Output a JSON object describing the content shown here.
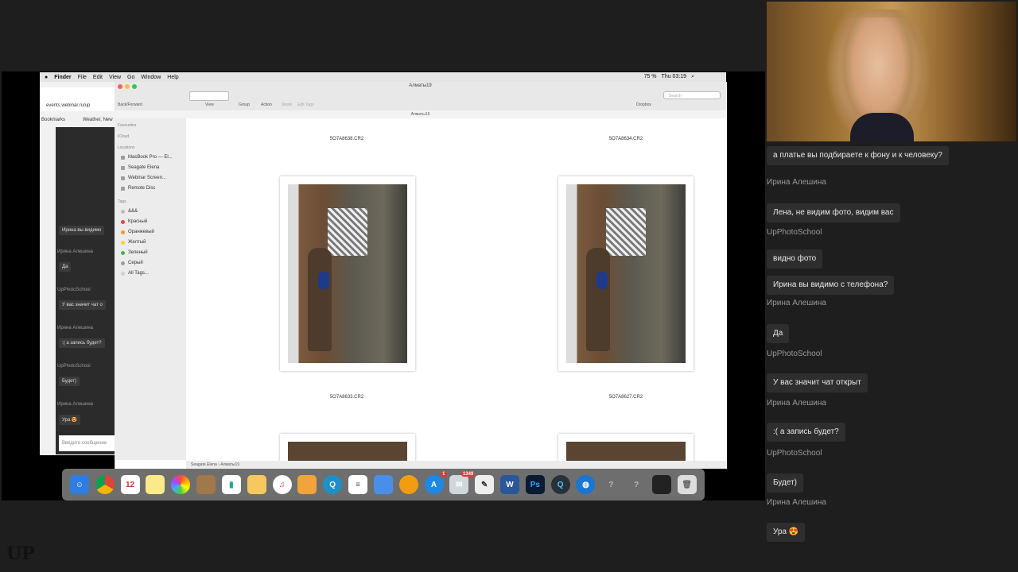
{
  "menubar": {
    "items": [
      "Finder",
      "File",
      "Edit",
      "View",
      "Go",
      "Window",
      "Help"
    ],
    "battery": "75 %",
    "time": "Thu 03:19"
  },
  "browser": {
    "url": "events.webinar.ru/up",
    "bookmarks": "Bookmarks",
    "weather": "Weather, New",
    "chat": [
      {
        "type": "msg",
        "text": "Ирина вы видимо"
      },
      {
        "type": "name",
        "text": "Ирина Алешина"
      },
      {
        "type": "msg",
        "text": "Да"
      },
      {
        "type": "name",
        "text": "UpPhotoSchool"
      },
      {
        "type": "msg",
        "text": "У вас значит чат о"
      },
      {
        "type": "name",
        "text": "Ирина Алешина"
      },
      {
        "type": "msg",
        "text": ":( а запись будет?"
      },
      {
        "type": "name",
        "text": "UpPhotoSchool"
      },
      {
        "type": "msg",
        "text": "Будет)"
      },
      {
        "type": "name",
        "text": "Ирина Алешина"
      },
      {
        "type": "msg",
        "text": "Ура 😍"
      }
    ],
    "input_placeholder": "Введите сообщение"
  },
  "finder": {
    "window_title": "Алматы19",
    "path_title": "Алматы19",
    "toolbar": {
      "back_forward": "Back/Forward",
      "view": "View",
      "group": "Group",
      "action": "Action",
      "share": "Share",
      "edit_tags": "Edit Tags",
      "dropbox": "Dropbox",
      "search": "Search",
      "search_placeholder": "Search"
    },
    "sidebar": {
      "favourites": "Favourites",
      "icloud": "iCloud",
      "locations_header": "Locations",
      "locations": [
        "MacBook Pro — El...",
        "Seagate Elena",
        "Webinar Screen...",
        "Remote Disc"
      ],
      "tags_header": "Tags",
      "tags": [
        {
          "label": "&&&",
          "color": "#bdbdbd"
        },
        {
          "label": "Красный",
          "color": "#e5453f"
        },
        {
          "label": "Оранжевый",
          "color": "#f29a2e"
        },
        {
          "label": "Желтый",
          "color": "#f4d03f"
        },
        {
          "label": "Зеленый",
          "color": "#4caf50"
        },
        {
          "label": "Серый",
          "color": "#9e9e9e"
        },
        {
          "label": "All Tags...",
          "color": "#cfcfcf"
        }
      ]
    },
    "files": [
      "5O7A8638.CR2",
      "5O7A8634.CR2",
      "5O7A8633.CR2",
      "5O7A8627.CR2"
    ],
    "statusbar": "Seagate Elena  ›  Алматы19"
  },
  "dock": {
    "badges": {
      "appstore": "1",
      "mail": "1349"
    }
  },
  "chat": {
    "messages": [
      {
        "type": "msg",
        "text": "а платье вы подбираете к фону и к человеку?"
      },
      {
        "type": "name",
        "text": "Ирина Алешина"
      },
      {
        "type": "msg",
        "text": "Лена, не видим фото, видим вас"
      },
      {
        "type": "name",
        "text": "UpPhotoSchool"
      },
      {
        "type": "msg",
        "text": "видно фото"
      },
      {
        "type": "msg",
        "text": "Ирина вы видимо с телефона?"
      },
      {
        "type": "name",
        "text": "Ирина Алешина"
      },
      {
        "type": "msg",
        "text": "Да"
      },
      {
        "type": "name",
        "text": "UpPhotoSchool"
      },
      {
        "type": "msg",
        "text": "У вас значит чат открыт"
      },
      {
        "type": "name",
        "text": "Ирина Алешина"
      },
      {
        "type": "msg",
        "text": ":( а запись будет?"
      },
      {
        "type": "name",
        "text": "UpPhotoSchool"
      },
      {
        "type": "msg",
        "text": "Будет)"
      },
      {
        "type": "name",
        "text": "Ирина Алешина"
      },
      {
        "type": "msg",
        "text": "Ура 😍"
      }
    ]
  },
  "logo": "UP"
}
